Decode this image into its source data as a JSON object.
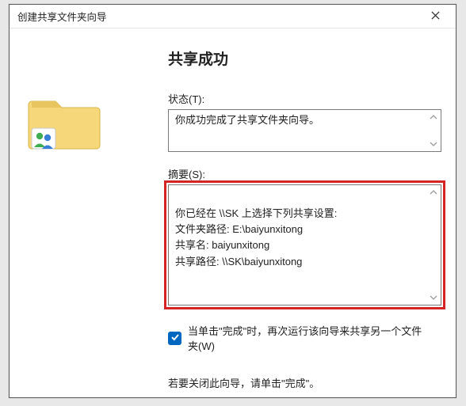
{
  "titlebar": {
    "title": "创建共享文件夹向导"
  },
  "main": {
    "heading": "共享成功",
    "status_label": "状态(T):",
    "status_text": "你成功完成了共享文件夹向导。",
    "summary_label": "摘要(S):",
    "summary_text": "你已经在 \\\\SK 上选择下列共享设置:\n文件夹路径: E:\\baiyunxitong\n共享名: baiyunxitong\n共享路径: \\\\SK\\baiyunxitong",
    "again_checkbox_label": "当单击\"完成\"时，再次运行该向导来共享另一个文件夹(W)",
    "again_checked": true,
    "close_note": "若要关闭此向导，请单击\"完成\"。"
  },
  "icons": {
    "close": "close-icon",
    "shared_folder": "shared-folder-icon"
  }
}
